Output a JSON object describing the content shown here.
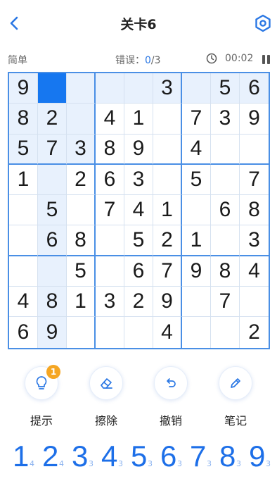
{
  "header": {
    "title": "关卡6"
  },
  "status": {
    "difficulty": "简单",
    "errors_label": "错误：",
    "errors_current": "0",
    "errors_total": "/3",
    "time": "00:02"
  },
  "board": {
    "selected": [
      0,
      1
    ],
    "rows": [
      [
        "9",
        "",
        "",
        "",
        "",
        "3",
        "",
        "5",
        "6"
      ],
      [
        "8",
        "2",
        "",
        "4",
        "1",
        "",
        "7",
        "3",
        "9"
      ],
      [
        "5",
        "7",
        "3",
        "8",
        "9",
        "",
        "4",
        "",
        ""
      ],
      [
        "1",
        "",
        "2",
        "6",
        "3",
        "",
        "5",
        "",
        "7"
      ],
      [
        "",
        "5",
        "",
        "7",
        "4",
        "1",
        "",
        "6",
        "8"
      ],
      [
        "",
        "6",
        "8",
        "",
        "5",
        "2",
        "1",
        "",
        "3"
      ],
      [
        "",
        "",
        "5",
        "",
        "6",
        "7",
        "9",
        "8",
        "4"
      ],
      [
        "4",
        "8",
        "1",
        "3",
        "2",
        "9",
        "",
        "7",
        ""
      ],
      [
        "6",
        "9",
        "",
        "",
        "",
        "4",
        "",
        "",
        "2"
      ]
    ]
  },
  "tools": {
    "hint_badge": "1",
    "items": [
      {
        "label": "提示",
        "icon": "bulb-icon"
      },
      {
        "label": "擦除",
        "icon": "eraser-icon"
      },
      {
        "label": "撤销",
        "icon": "undo-icon"
      },
      {
        "label": "笔记",
        "icon": "pencil-icon"
      }
    ]
  },
  "numpad": {
    "keys": [
      {
        "digit": "1",
        "count": "4"
      },
      {
        "digit": "2",
        "count": "4"
      },
      {
        "digit": "3",
        "count": "3"
      },
      {
        "digit": "4",
        "count": "3"
      },
      {
        "digit": "5",
        "count": "3"
      },
      {
        "digit": "6",
        "count": "3"
      },
      {
        "digit": "7",
        "count": "3"
      },
      {
        "digit": "8",
        "count": "3"
      },
      {
        "digit": "9",
        "count": "3"
      }
    ]
  },
  "colors": {
    "accent": "#1d6fe8",
    "grid_thick": "#4a8fe5",
    "highlight": "#e8f1fd",
    "selected": "#1677f0",
    "badge": "#f5a623"
  }
}
